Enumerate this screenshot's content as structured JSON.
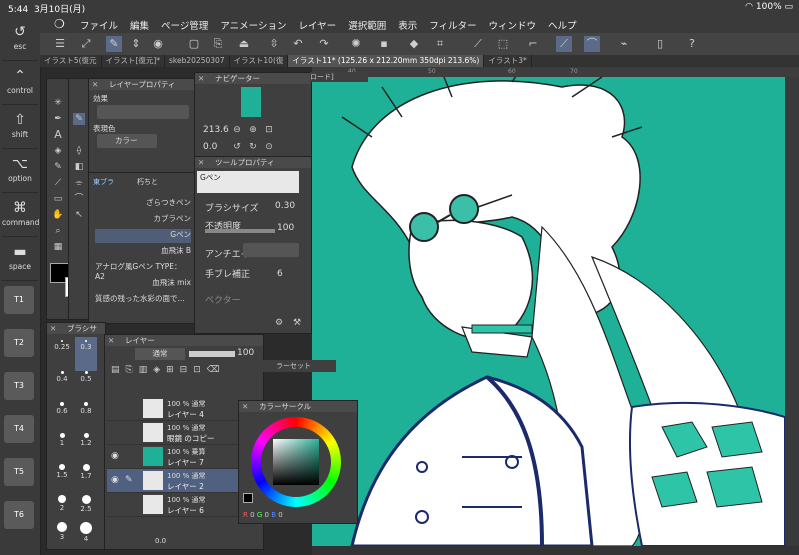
{
  "status": {
    "time": "5:44",
    "date": "3月10日(月)",
    "battery": "100%"
  },
  "menu": [
    "ファイル",
    "編集",
    "ページ管理",
    "アニメーション",
    "レイヤー",
    "選択範囲",
    "表示",
    "フィルター",
    "ウィンドウ",
    "ヘルプ"
  ],
  "tabs": [
    "イラスト5(復元",
    "イラスト[復元]*",
    "skeb20250307",
    "イラスト10(復",
    "イラスト11* (125.26 x 212.20mm 350dpi 213.6%)",
    "イラスト3*"
  ],
  "ruler": [
    "40",
    "50",
    "60",
    "70"
  ],
  "keys": [
    {
      "label": "esc",
      "icon": "undo-icon"
    },
    {
      "label": "control",
      "icon": "caret-icon"
    },
    {
      "label": "shift",
      "icon": "arrow-up-icon"
    },
    {
      "label": "option",
      "icon": "option-icon"
    },
    {
      "label": "command",
      "icon": "command-icon"
    },
    {
      "label": "space",
      "icon": "space-icon"
    }
  ],
  "tkeys": [
    "T1",
    "T2",
    "T3",
    "T4",
    "T5",
    "T6"
  ],
  "layer_property": {
    "title": "レイヤープロパティ",
    "effect": "効果",
    "expression_color": "表現色",
    "color_value": "カラー"
  },
  "brush_panel": {
    "tabs": [
      "東ブラ",
      "朽ちと"
    ],
    "brushes": [
      "ざらつきペン",
      "カブラペン",
      "Gペン",
      "血飛沫 B",
      "アナログ風Gペン TYPE：A2",
      "血飛沫 mix",
      "質感の残った水彩の面で..."
    ]
  },
  "navigator": {
    "title": "ナビゲーター",
    "zoom": "213.6",
    "rotation": "0.0",
    "thumb": "ロード]"
  },
  "tool_property": {
    "title": "ツールプロパティ",
    "tool": "Gペン",
    "brush_size_label": "ブラシサイズ",
    "brush_size": "0.30",
    "opacity_label": "不透明度",
    "opacity": "100",
    "antialias_label": "アンチエイ",
    "stabilization_label": "手ブレ補正",
    "stabilization": "6",
    "vector_label": "ベクター"
  },
  "brush_size_panel": {
    "title": "ブラシサ",
    "sizes": [
      "0.25",
      "0.3",
      "0.4",
      "0.5",
      "0.6",
      "0.8",
      "1",
      "1.2",
      "1.5",
      "1.7",
      "2",
      "2.5",
      "3",
      "4"
    ]
  },
  "layers": {
    "title": "レイヤー",
    "blend": "通常",
    "opacity": "100",
    "rows": [
      {
        "mode": "100 % 通常",
        "name": "レイヤー 4"
      },
      {
        "mode": "100 % 通常",
        "name": "眼鏡 のコピー"
      },
      {
        "mode": "100 % 乗算",
        "name": "レイヤー 7"
      },
      {
        "mode": "100 % 通常",
        "name": "レイヤー 2"
      },
      {
        "mode": "100 % 通常",
        "name": "レイヤー 6"
      }
    ],
    "bottom_value": "0.0"
  },
  "color_circle": {
    "title": "カラーサークル",
    "channels": [
      "R",
      "G",
      "B"
    ],
    "values": [
      "0",
      "0",
      "0"
    ]
  },
  "floating_label": "ラーセット",
  "colors": {
    "canvas": "#1fb197",
    "accent": "#5b6a88",
    "panel": "#3f3f3f",
    "main_color": "#000000",
    "sub_color": "#ffffff"
  }
}
